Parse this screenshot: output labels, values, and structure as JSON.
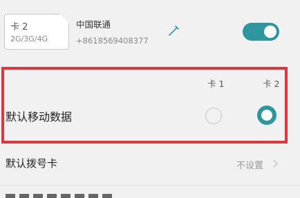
{
  "sim_card": {
    "chip_name": "卡 2",
    "chip_type": "2G/3G/4G",
    "carrier": "中国联通",
    "phone_number": "+8618569408377",
    "enabled": true
  },
  "default_mobile_data": {
    "label": "默认移动数据",
    "columns": [
      "卡 1",
      "卡 2"
    ],
    "selected": "卡 2"
  },
  "default_call": {
    "label": "默认拨号卡",
    "value": "不设置"
  },
  "colors": {
    "accent": "#2d969e",
    "highlight_border": "#e0353b",
    "background": "#f1f1f1"
  }
}
